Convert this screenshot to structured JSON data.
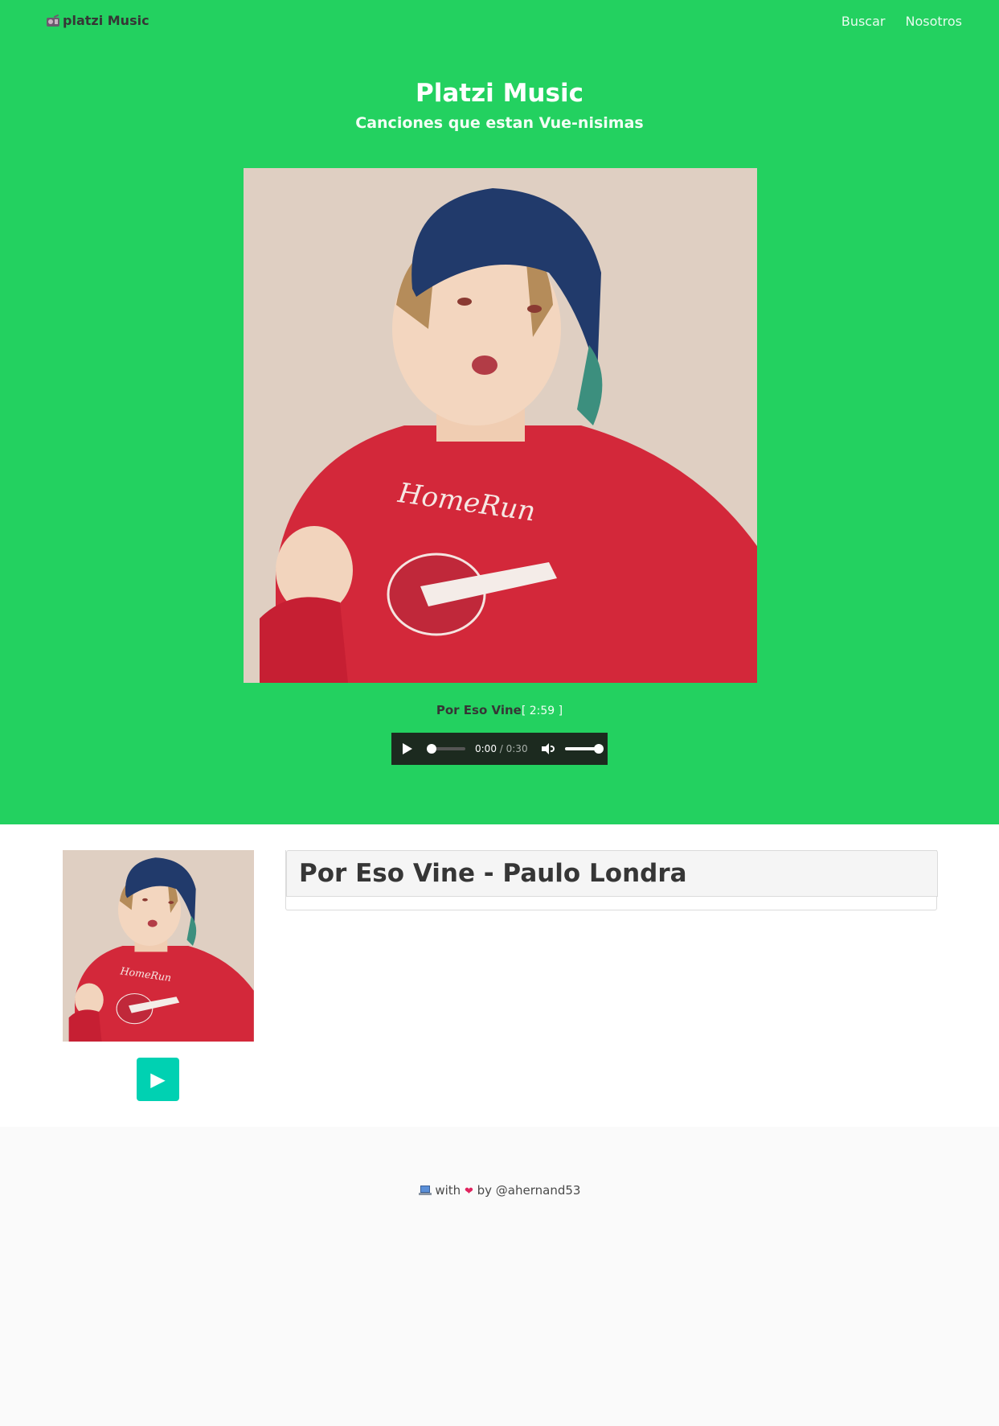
{
  "navbar": {
    "brand": "platzi Music",
    "brand_icon": "radio-icon",
    "links": [
      "Buscar",
      "Nosotros"
    ]
  },
  "hero": {
    "title": "Platzi Music",
    "subtitle": "Canciones que estan Vue-nisimas",
    "track_name": "Por Eso Vine",
    "track_duration": "[ 2:59 ]",
    "background_color": "#23d160"
  },
  "audio": {
    "current_time": "0:00",
    "separator": " / ",
    "total_time": "0:30",
    "progress": 0,
    "volume": 1.0
  },
  "track_card": {
    "title": "Por Eso Vine - Paulo Londra",
    "play_button_label": "▶",
    "play_button_color": "#00d1b2"
  },
  "footer": {
    "icon_laptop": "laptop-icon",
    "with_text": "with",
    "icon_heart": "heart-icon",
    "by_text": "by @ahernand53"
  }
}
